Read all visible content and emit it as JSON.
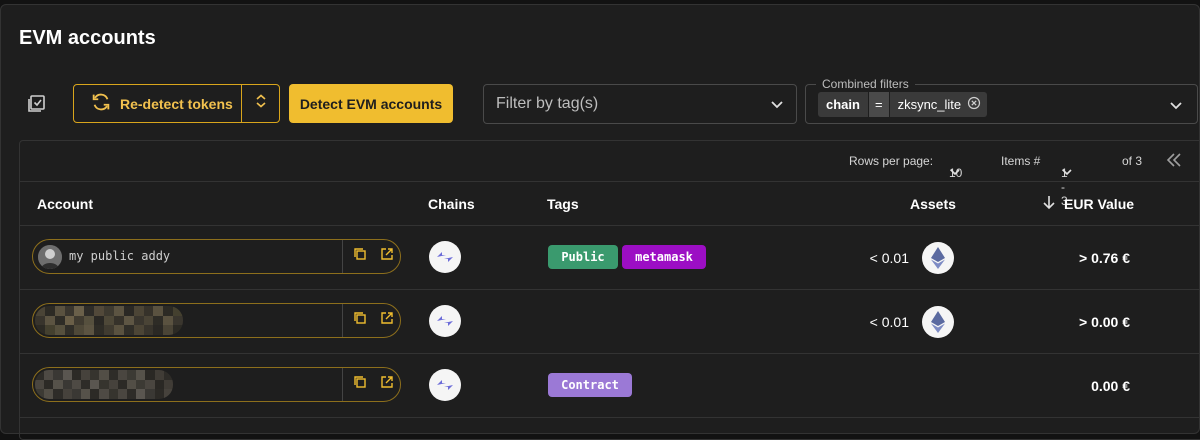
{
  "page": {
    "title": "EVM accounts"
  },
  "toolbar": {
    "redetect_label": "Re-detect tokens",
    "detect_label": "Detect EVM accounts",
    "tag_filter_placeholder": "Filter by tag(s)",
    "combined_filters_label": "Combined filters",
    "filter_chip": {
      "key": "chain",
      "operator": "=",
      "value": "zksync_lite"
    }
  },
  "pagination": {
    "rows_per_page_label": "Rows per page:",
    "rows_per_page_value": "10",
    "items_label": "Items #",
    "items_range": "1 - 3",
    "of_total": "of 3"
  },
  "table": {
    "headers": {
      "account": "Account",
      "chains": "Chains",
      "tags": "Tags",
      "assets": "Assets",
      "eur_value": "EUR Value"
    },
    "rows": [
      {
        "account_label": "my public addy",
        "tags": [
          "Public",
          "metamask"
        ],
        "assets_value": "< 0.01",
        "eur_value": "> 0.76 €"
      },
      {
        "account_label": "",
        "tags": [],
        "assets_value": "< 0.01",
        "eur_value": "> 0.00 €"
      },
      {
        "account_label": "",
        "tags": [
          "Contract"
        ],
        "assets_value": "",
        "eur_value": "0.00 €"
      }
    ]
  },
  "colors": {
    "accent": "#f0bd2f",
    "tag_public": "#3a9a6e",
    "tag_metamask": "#9c0ec4",
    "tag_contract": "#9b79d6"
  },
  "icons": [
    "select-all-icon",
    "refresh-icon",
    "unfold-icon",
    "chevron-down-icon",
    "close-circle-icon",
    "sort-arrow-icon",
    "first-page-icon",
    "copy-icon",
    "external-link-icon",
    "zksync-chain-icon",
    "ethereum-icon"
  ]
}
